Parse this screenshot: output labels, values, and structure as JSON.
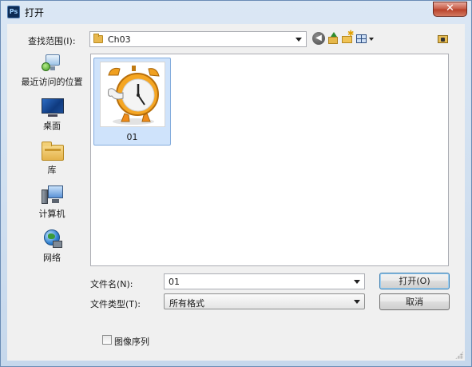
{
  "window": {
    "title": "打开",
    "app_icon_text": "Ps",
    "close_glyph": "✕"
  },
  "lookin": {
    "label": "查找范围(I):",
    "folder": "Ch03"
  },
  "toolbar": {
    "icons": [
      "back-icon",
      "up-folder-icon",
      "new-folder-icon",
      "view-menu-icon",
      "desktop-icon"
    ],
    "back_glyph": "◀",
    "new_glyph": "✱"
  },
  "places": [
    {
      "label": "最近访问的位置",
      "icon": "recent-places-icon"
    },
    {
      "label": "桌面",
      "icon": "desktop-icon"
    },
    {
      "label": "库",
      "icon": "libraries-icon"
    },
    {
      "label": "计算机",
      "icon": "computer-icon"
    },
    {
      "label": "网络",
      "icon": "network-icon"
    }
  ],
  "files": [
    {
      "name": "01",
      "thumbnail": "alarm-clock-thumbnail",
      "selected": true
    }
  ],
  "filename": {
    "label": "文件名(N):",
    "value": "01"
  },
  "filetype": {
    "label": "文件类型(T):",
    "value": "所有格式"
  },
  "buttons": {
    "open": "打开(O)",
    "cancel": "取消"
  },
  "image_sequence": {
    "label": "图像序列",
    "checked": false
  },
  "colors": {
    "selection": "#cfe3fb",
    "selection_border": "#84acdd",
    "frame": "#c6d8ec",
    "client": "#f0f0f0"
  }
}
